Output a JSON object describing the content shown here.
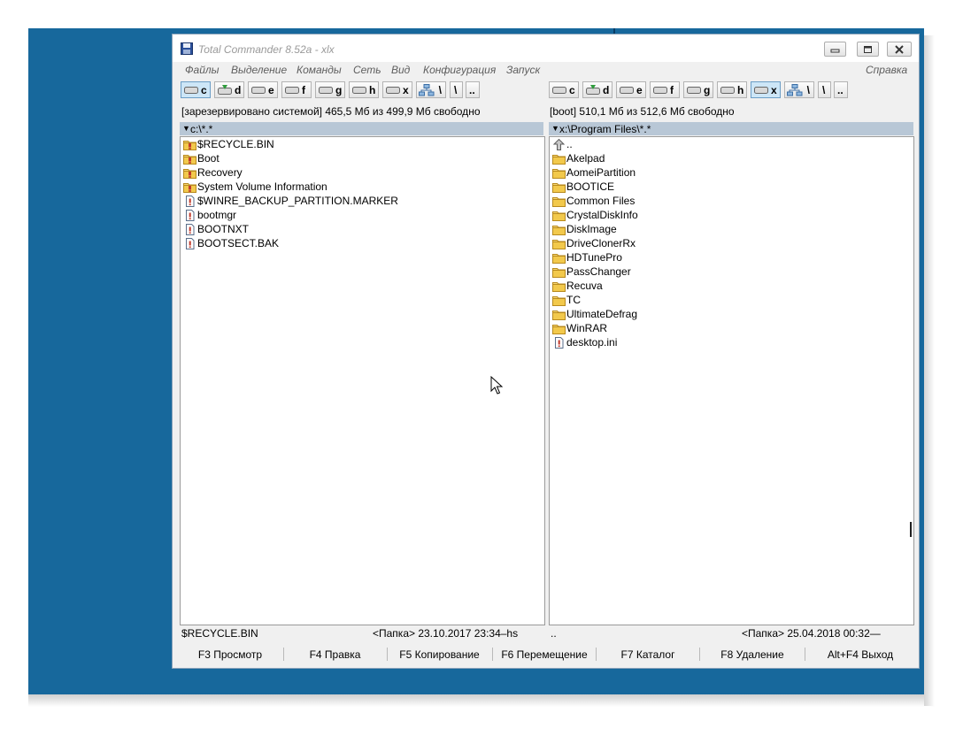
{
  "window": {
    "title": "Total Commander 8.52a - xlx"
  },
  "menu": {
    "items": [
      "Файлы",
      "Выделение",
      "Команды",
      "Сеть",
      "Вид",
      "Конфигурация",
      "Запуск"
    ],
    "help": "Справка"
  },
  "left_drives": {
    "letters": [
      "c",
      "d",
      "e",
      "f",
      "g",
      "h",
      "x"
    ],
    "active": "c",
    "root_label": "\\",
    "up_label": ".."
  },
  "right_drives": {
    "letters": [
      "c",
      "d",
      "e",
      "f",
      "g",
      "h",
      "x"
    ],
    "active": "x",
    "root_label": "\\",
    "up_label": ".."
  },
  "left_panel": {
    "free_info": "[зарезервировано системой]  465,5 Мб из 499,9 Мб свободно",
    "path": "c:\\*.*",
    "files": [
      {
        "name": "$RECYCLE.BIN",
        "icon": "system-folder-icon"
      },
      {
        "name": "Boot",
        "icon": "system-folder-icon"
      },
      {
        "name": "Recovery",
        "icon": "system-folder-icon"
      },
      {
        "name": "System Volume Information",
        "icon": "system-folder-icon"
      },
      {
        "name": "$WINRE_BACKUP_PARTITION.MARKER",
        "icon": "system-file-icon"
      },
      {
        "name": "bootmgr",
        "icon": "system-file-icon"
      },
      {
        "name": "BOOTNXT",
        "icon": "system-file-icon"
      },
      {
        "name": "BOOTSECT.BAK",
        "icon": "system-file-icon"
      }
    ],
    "status_name": "$RECYCLE.BIN",
    "status_info": "<Папка> 23.10.2017 23:34–hs"
  },
  "right_panel": {
    "free_info": "[boot]  510,1 Мб из 512,6 Мб свободно",
    "path": "x:\\Program Files\\*.*",
    "files": [
      {
        "name": "..",
        "icon": "up-dir-icon"
      },
      {
        "name": "Akelpad",
        "icon": "folder-icon"
      },
      {
        "name": "AomeiPartition",
        "icon": "folder-icon"
      },
      {
        "name": "BOOTICE",
        "icon": "folder-icon"
      },
      {
        "name": "Common Files",
        "icon": "folder-icon"
      },
      {
        "name": "CrystalDiskInfo",
        "icon": "folder-icon"
      },
      {
        "name": "DiskImage",
        "icon": "folder-icon"
      },
      {
        "name": "DriveClonerRx",
        "icon": "folder-icon"
      },
      {
        "name": "HDTunePro",
        "icon": "folder-icon"
      },
      {
        "name": "PassChanger",
        "icon": "folder-icon"
      },
      {
        "name": "Recuva",
        "icon": "folder-icon"
      },
      {
        "name": "TC",
        "icon": "folder-icon"
      },
      {
        "name": "UltimateDefrag",
        "icon": "folder-icon"
      },
      {
        "name": "WinRAR",
        "icon": "folder-icon"
      },
      {
        "name": "desktop.ini",
        "icon": "system-file-icon"
      }
    ],
    "status_name": "..",
    "status_info": "<Папка> 25.04.2018 00:32—"
  },
  "function_keys": [
    "F3 Просмотр",
    "F4 Правка",
    "F5 Копирование",
    "F6 Перемещение",
    "F7 Каталог",
    "F8 Удаление",
    "Alt+F4 Выход"
  ]
}
